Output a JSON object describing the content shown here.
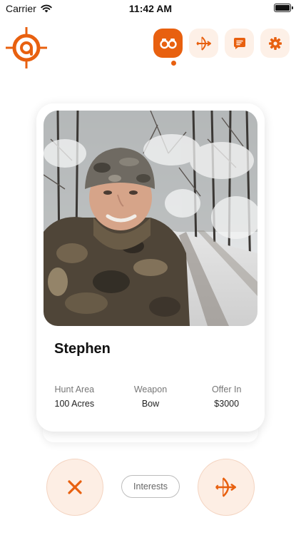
{
  "status_bar": {
    "carrier": "Carrier",
    "time": "11:42 AM"
  },
  "header": {
    "logo_icon": "crosshair-target-logo",
    "nav": [
      {
        "name": "discover",
        "icon": "binoculars-icon",
        "active": true
      },
      {
        "name": "hunts",
        "icon": "bow-arrow-icon",
        "active": false
      },
      {
        "name": "messages",
        "icon": "chat-icon",
        "active": false
      },
      {
        "name": "settings",
        "icon": "gear-icon",
        "active": false
      }
    ]
  },
  "profile": {
    "name": "Stephen",
    "stats": [
      {
        "label": "Hunt Area",
        "value": "100 Acres"
      },
      {
        "label": "Weapon",
        "value": "Bow"
      },
      {
        "label": "Offer In",
        "value": "$3000"
      }
    ]
  },
  "actions": {
    "dislike_icon": "close-icon",
    "interests_label": "Interests",
    "like_icon": "bow-arrow-icon"
  },
  "colors": {
    "accent": "#e8600f",
    "accent_light": "#fdeee4",
    "text_muted": "#777777"
  }
}
